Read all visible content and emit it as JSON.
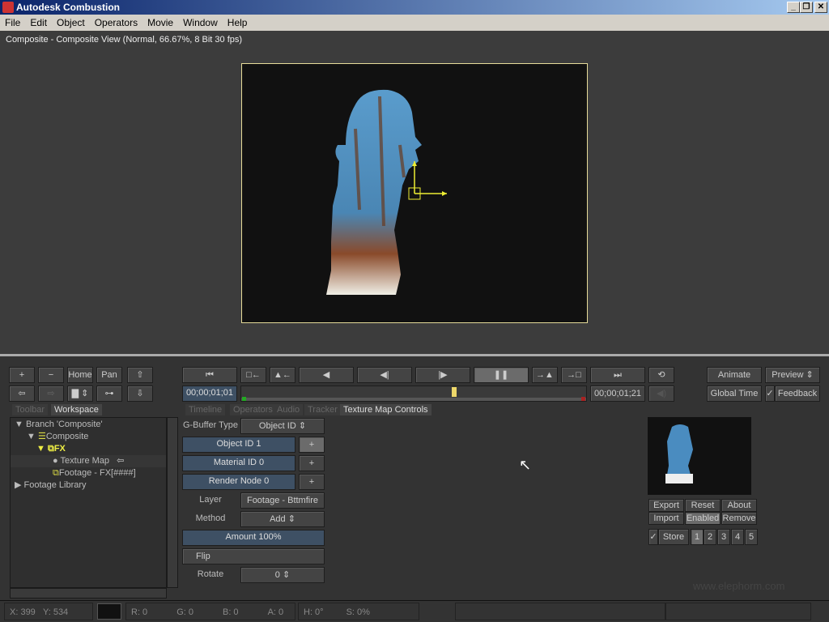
{
  "window": {
    "title": "Autodesk Combustion",
    "controls": [
      "_",
      "❐",
      "✕"
    ]
  },
  "menu": [
    "File",
    "Edit",
    "Object",
    "Operators",
    "Movie",
    "Window",
    "Help"
  ],
  "viewer": {
    "title": "Composite - Composite View (Normal, 66.67%, 8 Bit 30 fps)",
    "frame_border_color": "#e6dc9a"
  },
  "nav": {
    "plus": "+",
    "minus": "−",
    "home": "Home",
    "pan": "Pan"
  },
  "left_tabs": [
    "Toolbar",
    "Workspace"
  ],
  "tree": {
    "items": [
      "Branch 'Composite'",
      "Composite",
      "FX",
      "Texture Map",
      "Footage - FX[####]",
      "Footage Library"
    ]
  },
  "transport": {
    "current_time": "00;00;01;01",
    "end_time": "00;00;01;21",
    "playhead_fraction": 0.62
  },
  "center_tabs": [
    "Timeline",
    "Operators",
    "Audio",
    "Tracker",
    "Texture Map Controls"
  ],
  "controls": {
    "gbuffer_label": "G-Buffer Type",
    "gbuffer_value": "Object ID",
    "object_id": "Object ID 1",
    "material_id": "Material ID 0",
    "render_node": "Render Node 0",
    "layer_label": "Layer",
    "layer_value": "Footage - Bttmfire",
    "method_label": "Method",
    "method_value": "Add",
    "amount": "Amount 100%",
    "flip": "Flip",
    "rotate_label": "Rotate",
    "rotate_value": "0"
  },
  "right": {
    "animate": "Animate",
    "preview": "Preview",
    "global_time": "Global Time",
    "feedback": "Feedback",
    "export": "Export",
    "reset": "Reset",
    "about": "About",
    "import": "Import",
    "enabled": "Enabled",
    "remove": "Remove",
    "store": "Store",
    "slots": [
      "1",
      "2",
      "3",
      "4",
      "5"
    ],
    "watermark": "www.elephorm.com"
  },
  "status": {
    "x": "X:  399",
    "y": "Y:  534",
    "r": "R: 0",
    "g": "G: 0",
    "b": "B: 0",
    "a": "A: 0",
    "h": "H: 0°",
    "s": "S: 0%"
  }
}
